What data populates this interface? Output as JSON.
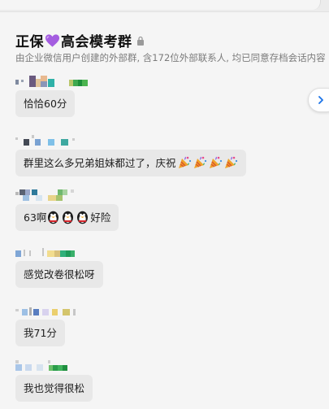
{
  "header": {
    "title_part1": "正保",
    "title_part2": "高会模考群",
    "subtitle": "由企业微信用户创建的外部群, 含172位外部联系人, 均已同意存档会话内容"
  },
  "icons": {
    "heart": "purple-heart-icon",
    "lock": "lock-icon",
    "party": "party-popper-icon",
    "qq": "penguin-emoji-icon",
    "collapse": "chevron-right-icon"
  },
  "colors": {
    "heart": "#9b5de5",
    "bubble": "#e8e8e8",
    "accent": "#1a73e8"
  },
  "messages": [
    {
      "text": "恰恰60分"
    },
    {
      "text": "群里这么多兄弟姐妹都过了，庆祝"
    },
    {
      "text_before": "63啊",
      "text_after": "好险"
    },
    {
      "text": "感觉改卷很松呀"
    },
    {
      "text": "我71分"
    },
    {
      "text": "我也觉得很松"
    }
  ]
}
